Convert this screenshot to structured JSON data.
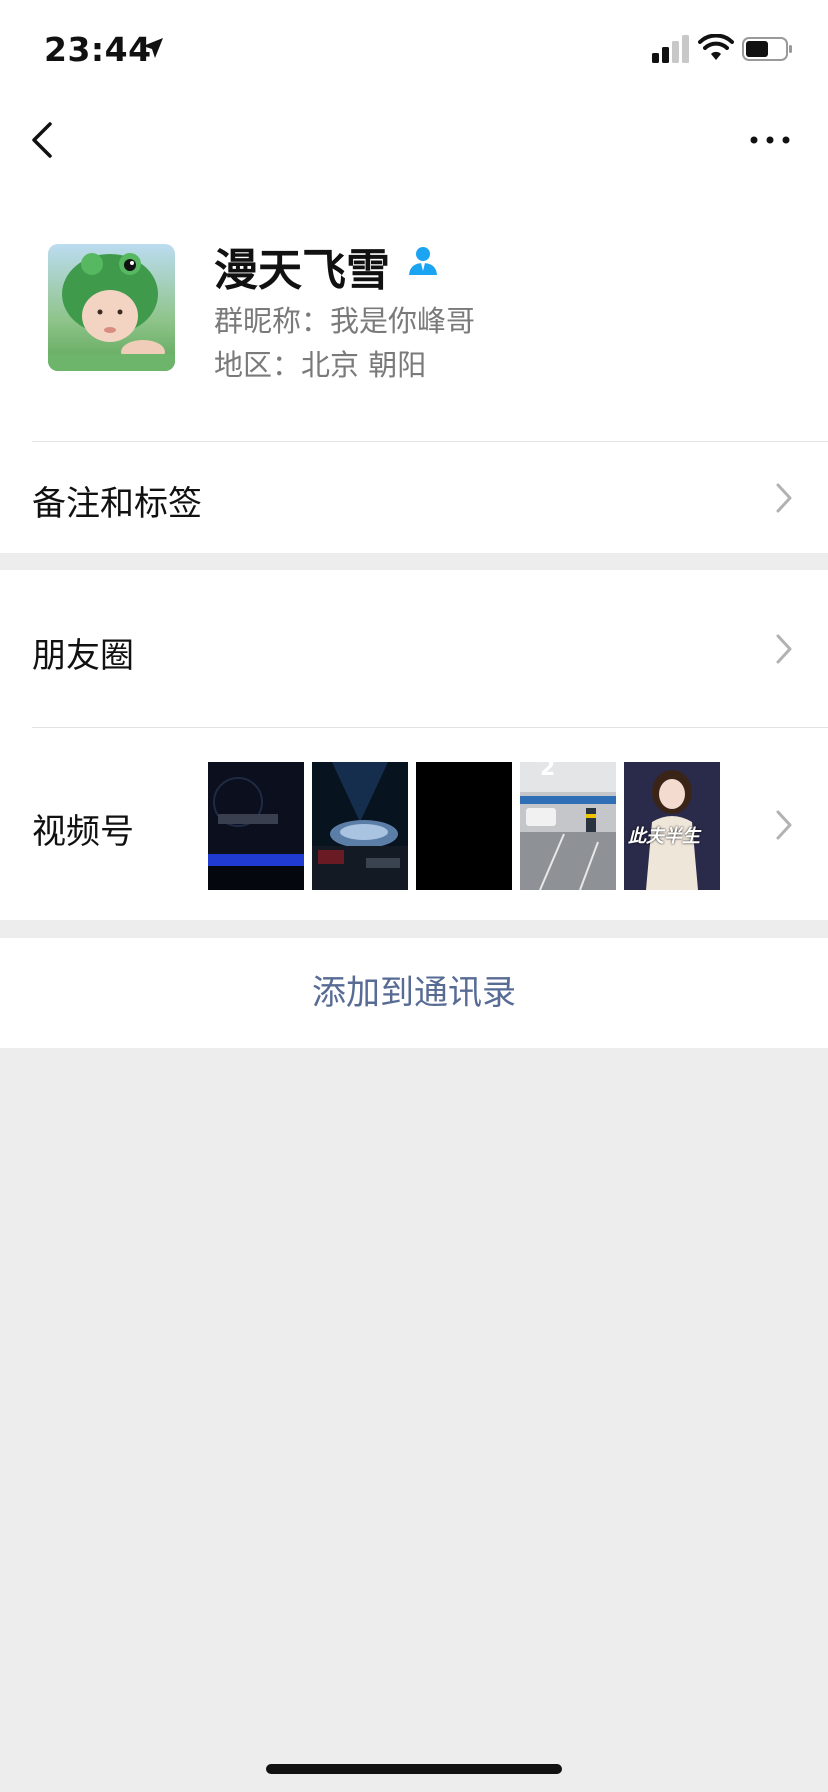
{
  "status_bar": {
    "time": "23:44"
  },
  "profile": {
    "name": "漫天飞雪",
    "group_nickname": "群昵称：我是你峰哥",
    "region": "地区：北京 朝阳"
  },
  "cells": {
    "remark_label": "备注和标签",
    "moments_label": "朋友圈",
    "channels_label": "视频号"
  },
  "channels_thumbs": [
    {
      "icon": "night-ferris-wheel-thumbnail"
    },
    {
      "icon": "stage-concert-thumbnail"
    },
    {
      "icon": "black-video-thumbnail",
      "label": ""
    },
    {
      "icon": "parking-garage-thumbnail",
      "label": "2"
    },
    {
      "icon": "singer-woman-thumbnail",
      "label": "此夫半生"
    }
  ],
  "action": {
    "add_contact": "添加到通讯录"
  },
  "colors": {
    "link": "#576b95",
    "person_icon": "#1aa4f1",
    "background": "#ededed"
  }
}
